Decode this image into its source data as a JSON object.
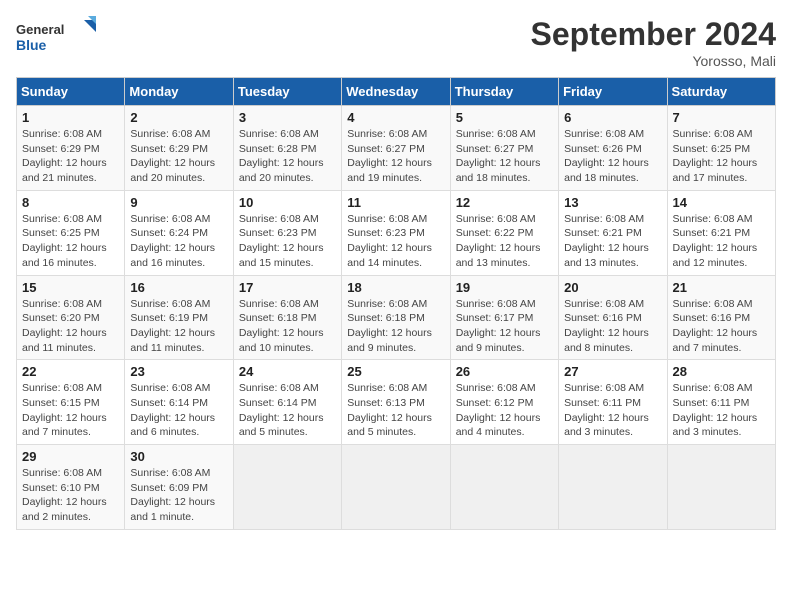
{
  "header": {
    "logo_general": "General",
    "logo_blue": "Blue",
    "title": "September 2024",
    "subtitle": "Yorosso, Mali"
  },
  "columns": [
    "Sunday",
    "Monday",
    "Tuesday",
    "Wednesday",
    "Thursday",
    "Friday",
    "Saturday"
  ],
  "weeks": [
    [
      {
        "day": "1",
        "lines": [
          "Sunrise: 6:08 AM",
          "Sunset: 6:29 PM",
          "Daylight: 12 hours",
          "and 21 minutes."
        ]
      },
      {
        "day": "2",
        "lines": [
          "Sunrise: 6:08 AM",
          "Sunset: 6:29 PM",
          "Daylight: 12 hours",
          "and 20 minutes."
        ]
      },
      {
        "day": "3",
        "lines": [
          "Sunrise: 6:08 AM",
          "Sunset: 6:28 PM",
          "Daylight: 12 hours",
          "and 20 minutes."
        ]
      },
      {
        "day": "4",
        "lines": [
          "Sunrise: 6:08 AM",
          "Sunset: 6:27 PM",
          "Daylight: 12 hours",
          "and 19 minutes."
        ]
      },
      {
        "day": "5",
        "lines": [
          "Sunrise: 6:08 AM",
          "Sunset: 6:27 PM",
          "Daylight: 12 hours",
          "and 18 minutes."
        ]
      },
      {
        "day": "6",
        "lines": [
          "Sunrise: 6:08 AM",
          "Sunset: 6:26 PM",
          "Daylight: 12 hours",
          "and 18 minutes."
        ]
      },
      {
        "day": "7",
        "lines": [
          "Sunrise: 6:08 AM",
          "Sunset: 6:25 PM",
          "Daylight: 12 hours",
          "and 17 minutes."
        ]
      }
    ],
    [
      {
        "day": "8",
        "lines": [
          "Sunrise: 6:08 AM",
          "Sunset: 6:25 PM",
          "Daylight: 12 hours",
          "and 16 minutes."
        ]
      },
      {
        "day": "9",
        "lines": [
          "Sunrise: 6:08 AM",
          "Sunset: 6:24 PM",
          "Daylight: 12 hours",
          "and 16 minutes."
        ]
      },
      {
        "day": "10",
        "lines": [
          "Sunrise: 6:08 AM",
          "Sunset: 6:23 PM",
          "Daylight: 12 hours",
          "and 15 minutes."
        ]
      },
      {
        "day": "11",
        "lines": [
          "Sunrise: 6:08 AM",
          "Sunset: 6:23 PM",
          "Daylight: 12 hours",
          "and 14 minutes."
        ]
      },
      {
        "day": "12",
        "lines": [
          "Sunrise: 6:08 AM",
          "Sunset: 6:22 PM",
          "Daylight: 12 hours",
          "and 13 minutes."
        ]
      },
      {
        "day": "13",
        "lines": [
          "Sunrise: 6:08 AM",
          "Sunset: 6:21 PM",
          "Daylight: 12 hours",
          "and 13 minutes."
        ]
      },
      {
        "day": "14",
        "lines": [
          "Sunrise: 6:08 AM",
          "Sunset: 6:21 PM",
          "Daylight: 12 hours",
          "and 12 minutes."
        ]
      }
    ],
    [
      {
        "day": "15",
        "lines": [
          "Sunrise: 6:08 AM",
          "Sunset: 6:20 PM",
          "Daylight: 12 hours",
          "and 11 minutes."
        ]
      },
      {
        "day": "16",
        "lines": [
          "Sunrise: 6:08 AM",
          "Sunset: 6:19 PM",
          "Daylight: 12 hours",
          "and 11 minutes."
        ]
      },
      {
        "day": "17",
        "lines": [
          "Sunrise: 6:08 AM",
          "Sunset: 6:18 PM",
          "Daylight: 12 hours",
          "and 10 minutes."
        ]
      },
      {
        "day": "18",
        "lines": [
          "Sunrise: 6:08 AM",
          "Sunset: 6:18 PM",
          "Daylight: 12 hours",
          "and 9 minutes."
        ]
      },
      {
        "day": "19",
        "lines": [
          "Sunrise: 6:08 AM",
          "Sunset: 6:17 PM",
          "Daylight: 12 hours",
          "and 9 minutes."
        ]
      },
      {
        "day": "20",
        "lines": [
          "Sunrise: 6:08 AM",
          "Sunset: 6:16 PM",
          "Daylight: 12 hours",
          "and 8 minutes."
        ]
      },
      {
        "day": "21",
        "lines": [
          "Sunrise: 6:08 AM",
          "Sunset: 6:16 PM",
          "Daylight: 12 hours",
          "and 7 minutes."
        ]
      }
    ],
    [
      {
        "day": "22",
        "lines": [
          "Sunrise: 6:08 AM",
          "Sunset: 6:15 PM",
          "Daylight: 12 hours",
          "and 7 minutes."
        ]
      },
      {
        "day": "23",
        "lines": [
          "Sunrise: 6:08 AM",
          "Sunset: 6:14 PM",
          "Daylight: 12 hours",
          "and 6 minutes."
        ]
      },
      {
        "day": "24",
        "lines": [
          "Sunrise: 6:08 AM",
          "Sunset: 6:14 PM",
          "Daylight: 12 hours",
          "and 5 minutes."
        ]
      },
      {
        "day": "25",
        "lines": [
          "Sunrise: 6:08 AM",
          "Sunset: 6:13 PM",
          "Daylight: 12 hours",
          "and 5 minutes."
        ]
      },
      {
        "day": "26",
        "lines": [
          "Sunrise: 6:08 AM",
          "Sunset: 6:12 PM",
          "Daylight: 12 hours",
          "and 4 minutes."
        ]
      },
      {
        "day": "27",
        "lines": [
          "Sunrise: 6:08 AM",
          "Sunset: 6:11 PM",
          "Daylight: 12 hours",
          "and 3 minutes."
        ]
      },
      {
        "day": "28",
        "lines": [
          "Sunrise: 6:08 AM",
          "Sunset: 6:11 PM",
          "Daylight: 12 hours",
          "and 3 minutes."
        ]
      }
    ],
    [
      {
        "day": "29",
        "lines": [
          "Sunrise: 6:08 AM",
          "Sunset: 6:10 PM",
          "Daylight: 12 hours",
          "and 2 minutes."
        ]
      },
      {
        "day": "30",
        "lines": [
          "Sunrise: 6:08 AM",
          "Sunset: 6:09 PM",
          "Daylight: 12 hours",
          "and 1 minute."
        ]
      },
      null,
      null,
      null,
      null,
      null
    ]
  ]
}
